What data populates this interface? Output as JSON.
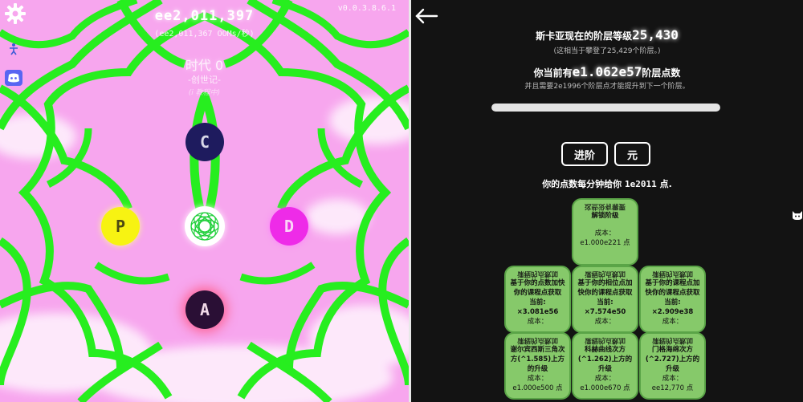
{
  "left": {
    "points": "ee2,011,397",
    "rate": "(ee2,011,367 OOMs/秒)",
    "era_title": "时代 0",
    "era_subtitle": "-创世记-",
    "era_hint": "(i 教程中)",
    "version": "v0.0.3.8.6.1",
    "nodes": {
      "c": "C",
      "p": "P",
      "d": "D",
      "a": "A"
    },
    "icons": {
      "settings": "gear-icon",
      "profile": "person-icon",
      "community": "discord-icon"
    },
    "colors": {
      "background": "#f7a6ee",
      "pattern": "#27ee1f",
      "node_c": "#1e1b5e",
      "node_p": "#f7f312",
      "node_d": "#ee2be8",
      "node_a": "#2a0f35"
    }
  },
  "right": {
    "rank_prefix": "斯卡亚现在的阶层等级",
    "rank_value": "25,430",
    "rank_sub": "(这相当于攀登了25,429个阶层。)",
    "points_prefix": "你当前有",
    "points_value": "e1.062e57",
    "points_suffix": "阶层点数",
    "points_sub": "并且需要2e1996个阶层点才能提升到下一个阶层。",
    "progress_fraction": 1.0,
    "buttons": {
      "advance": "进阶",
      "element": "元"
    },
    "gain_prefix": "你的点数每分钟给你",
    "gain_value": "1e2011",
    "gain_suffix": "点.",
    "cards": [
      {
        "flipped": "这些没有需要",
        "lines": [
          "解锁阶级"
        ],
        "cost_label": "成本：",
        "cost": "e1.000e221 点"
      },
      {
        "flipped": "课程的点数加",
        "lines": [
          "基于你的点数加快你的课程点获取",
          "当前:",
          "×3.081e56"
        ],
        "cost_label": "成本：",
        "cost": ""
      },
      {
        "flipped": "课程的点数加",
        "lines": [
          "基于你的相位点加快你的课程点获取",
          "当前:",
          "×7.574e50"
        ],
        "cost_label": "成本：",
        "cost": ""
      },
      {
        "flipped": "课程的点数加",
        "lines": [
          "基于你的课程点加快你的课程点获取",
          "当前:",
          "×2.909e38"
        ],
        "cost_label": "成本：",
        "cost": ""
      },
      {
        "flipped": "课程的点数加",
        "lines": [
          "谢尔宾西斯三角次方(^1.585)上方的升级"
        ],
        "cost_label": "成本：",
        "cost": "e1.000e500 点"
      },
      {
        "flipped": "课程的点数加",
        "lines": [
          "科赫曲线次方(^1.262)上方的升级"
        ],
        "cost_label": "成本：",
        "cost": "e1.000e670 点"
      },
      {
        "flipped": "课程的点数加",
        "lines": [
          "门格海绵次方(^2.727)上方的升级"
        ],
        "cost_label": "成本：",
        "cost": "ee12,770 点"
      }
    ],
    "icons": {
      "back": "back-arrow-icon",
      "side": "cat-icon"
    },
    "colors": {
      "card": "#86c96a",
      "card_border": "#5aa447",
      "background": "#131313"
    }
  }
}
